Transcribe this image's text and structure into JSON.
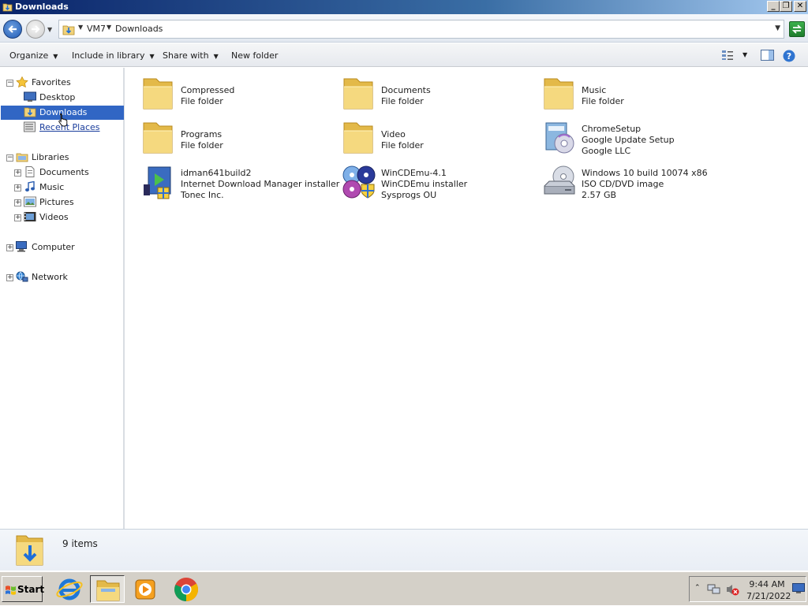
{
  "window": {
    "title": "Downloads"
  },
  "address": {
    "crumbs": [
      "VM7",
      "Downloads"
    ]
  },
  "commands": {
    "organize": "Organize",
    "include_in_library": "Include in library",
    "share_with": "Share with",
    "new_folder": "New folder"
  },
  "nav": {
    "favorites": "Favorites",
    "desktop": "Desktop",
    "downloads": "Downloads",
    "recent_places": "Recent Places",
    "libraries": "Libraries",
    "documents": "Documents",
    "music": "Music",
    "pictures": "Pictures",
    "videos": "Videos",
    "computer": "Computer",
    "network": "Network"
  },
  "items": [
    {
      "name": "Compressed",
      "type": "File folder",
      "icon": "folder-icon"
    },
    {
      "name": "Documents",
      "type": "File folder",
      "icon": "folder-icon"
    },
    {
      "name": "Music",
      "type": "File folder",
      "icon": "folder-icon"
    },
    {
      "name": "Programs",
      "type": "File folder",
      "icon": "folder-icon"
    },
    {
      "name": "Video",
      "type": "File folder",
      "icon": "folder-icon"
    },
    {
      "name": "ChromeSetup",
      "type": "Google Update Setup",
      "extra": "Google LLC",
      "icon": "installer-icon"
    },
    {
      "name": "idman641build2",
      "type": "Internet Download Manager installer",
      "extra": "Tonec Inc.",
      "icon": "idm-icon"
    },
    {
      "name": "WinCDEmu-4.1",
      "type": "WinCDEmu installer",
      "extra": "Sysprogs OU",
      "icon": "discs-icon"
    },
    {
      "name": "Windows 10 build 10074 x86",
      "type": "ISO CD/DVD image",
      "extra": "2.57 GB",
      "icon": "disc-drive-icon"
    }
  ],
  "details": {
    "count": "9 items"
  },
  "taskbar": {
    "start": "Start",
    "time": "9:44 AM",
    "date": "7/21/2022"
  },
  "colors": {
    "selection": "#3166c4",
    "titlebar": "#0a246a"
  }
}
